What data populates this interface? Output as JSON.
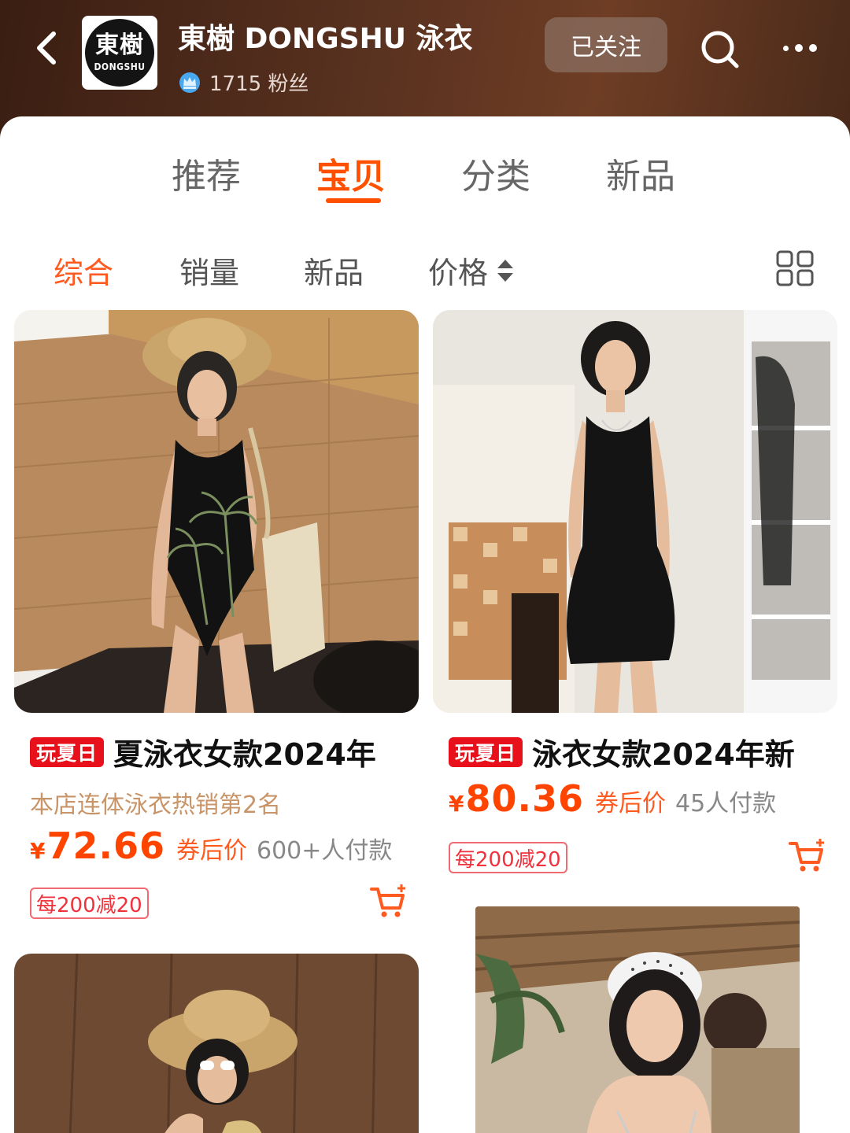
{
  "shop": {
    "logo_text_cjk": "東樹",
    "logo_text_latin": "DONGSHU",
    "name": "東樹 DONGSHU 泳衣",
    "fans": "1715 粉丝",
    "follow_label": "已关注"
  },
  "tabs": [
    {
      "label": "推荐",
      "active": false
    },
    {
      "label": "宝贝",
      "active": true
    },
    {
      "label": "分类",
      "active": false
    },
    {
      "label": "新品",
      "active": false
    }
  ],
  "sort_options": [
    {
      "label": "综合",
      "active": true
    },
    {
      "label": "销量",
      "active": false
    },
    {
      "label": "新品",
      "active": false
    },
    {
      "label": "价格",
      "active": false
    }
  ],
  "products": [
    {
      "tag": "玩夏日",
      "title": "夏泳衣女款2024年",
      "rank": "本店连体泳衣热销第2名",
      "currency": "¥",
      "price": "72.66",
      "price_label": "券后价",
      "sales": "600+人付款",
      "coupon": "每200减20"
    },
    {
      "tag": "玩夏日",
      "title": "泳衣女款2024年新",
      "currency": "¥",
      "price": "80.36",
      "price_label": "券后价",
      "sales": "45人付款",
      "coupon": "每200减20"
    }
  ],
  "colors": {
    "accent": "#ff5000",
    "price": "#ff4400",
    "promo_tag": "#e8101a",
    "header_bg": "#5a3220"
  },
  "icons": [
    "back-chevron-icon",
    "crown-icon",
    "search-icon",
    "more-icon",
    "sort-arrows-icon",
    "grid-view-icon",
    "cart-add-icon"
  ]
}
